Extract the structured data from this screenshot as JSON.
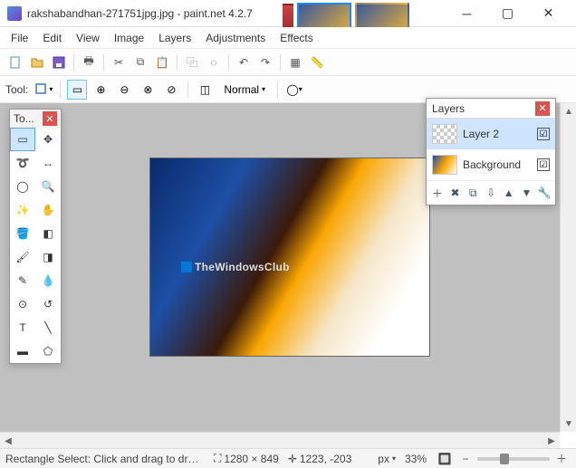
{
  "titlebar": {
    "text": "rakshabandhan-271751jpg.jpg - paint.net 4.2.7"
  },
  "menu": {
    "items": [
      "File",
      "Edit",
      "View",
      "Image",
      "Layers",
      "Adjustments",
      "Effects"
    ]
  },
  "tooloptions": {
    "label": "Tool:",
    "blendmode": "Normal"
  },
  "tools_panel": {
    "title": "To..."
  },
  "layers_panel": {
    "title": "Layers",
    "rows": [
      {
        "name": "Layer 2",
        "checked": true
      },
      {
        "name": "Background",
        "checked": true
      }
    ]
  },
  "watermark": {
    "text": "TheWindowsClub"
  },
  "statusbar": {
    "hint": "Rectangle Select: Click and drag to draw a rectangular selection. Hol...",
    "dims": "1280 × 849",
    "cursor": "1223, -203",
    "unit": "px",
    "zoom": "33%"
  }
}
